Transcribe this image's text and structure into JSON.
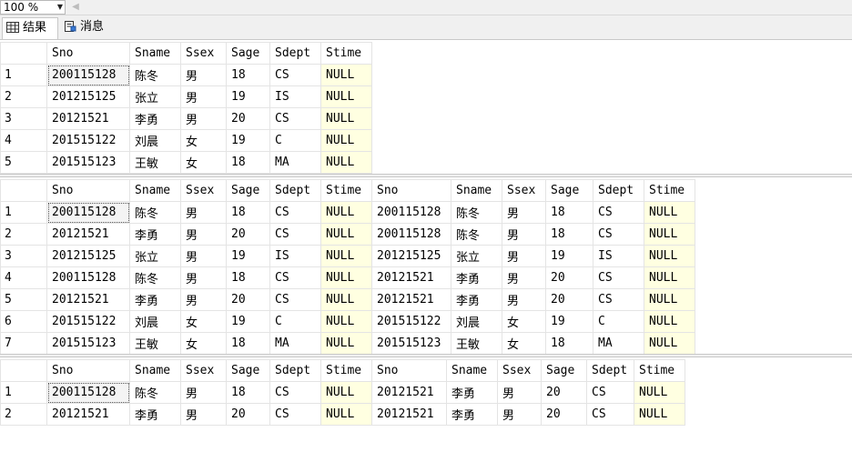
{
  "toolbar": {
    "zoom": "100 %"
  },
  "tabs": [
    {
      "label": "结果"
    },
    {
      "label": "消息"
    }
  ],
  "grids": [
    {
      "columns": [
        "Sno",
        "Sname",
        "Ssex",
        "Sage",
        "Sdept",
        "Stime"
      ],
      "rows": [
        [
          "1",
          "200115128",
          "陈冬",
          "男",
          "18",
          "CS",
          "NULL"
        ],
        [
          "2",
          "201215125",
          "张立",
          "男",
          "19",
          "IS",
          "NULL"
        ],
        [
          "3",
          "20121521",
          "李勇",
          "男",
          "20",
          "CS",
          "NULL"
        ],
        [
          "4",
          "201515122",
          "刘晨",
          "女",
          "19",
          "C",
          "NULL"
        ],
        [
          "5",
          "201515123",
          "王敏",
          "女",
          "18",
          "MA",
          "NULL"
        ]
      ]
    },
    {
      "columns": [
        "Sno",
        "Sname",
        "Ssex",
        "Sage",
        "Sdept",
        "Stime",
        "Sno",
        "Sname",
        "Ssex",
        "Sage",
        "Sdept",
        "Stime"
      ],
      "rows": [
        [
          "1",
          "200115128",
          "陈冬",
          "男",
          "18",
          "CS",
          "NULL",
          "200115128",
          "陈冬",
          "男",
          "18",
          "CS",
          "NULL"
        ],
        [
          "2",
          "20121521",
          "李勇",
          "男",
          "20",
          "CS",
          "NULL",
          "200115128",
          "陈冬",
          "男",
          "18",
          "CS",
          "NULL"
        ],
        [
          "3",
          "201215125",
          "张立",
          "男",
          "19",
          "IS",
          "NULL",
          "201215125",
          "张立",
          "男",
          "19",
          "IS",
          "NULL"
        ],
        [
          "4",
          "200115128",
          "陈冬",
          "男",
          "18",
          "CS",
          "NULL",
          "20121521",
          "李勇",
          "男",
          "20",
          "CS",
          "NULL"
        ],
        [
          "5",
          "20121521",
          "李勇",
          "男",
          "20",
          "CS",
          "NULL",
          "20121521",
          "李勇",
          "男",
          "20",
          "CS",
          "NULL"
        ],
        [
          "6",
          "201515122",
          "刘晨",
          "女",
          "19",
          "C",
          "NULL",
          "201515122",
          "刘晨",
          "女",
          "19",
          "C",
          "NULL"
        ],
        [
          "7",
          "201515123",
          "王敏",
          "女",
          "18",
          "MA",
          "NULL",
          "201515123",
          "王敏",
          "女",
          "18",
          "MA",
          "NULL"
        ]
      ]
    },
    {
      "columns": [
        "Sno",
        "Sname",
        "Ssex",
        "Sage",
        "Sdept",
        "Stime",
        "Sno",
        "Sname",
        "Ssex",
        "Sage",
        "Sdept",
        "Stime"
      ],
      "rows": [
        [
          "1",
          "200115128",
          "陈冬",
          "男",
          "18",
          "CS",
          "NULL",
          "20121521",
          "李勇",
          "男",
          "20",
          "CS",
          "NULL"
        ],
        [
          "2",
          "20121521",
          "李勇",
          "男",
          "20",
          "CS",
          "NULL",
          "20121521",
          "李勇",
          "男",
          "20",
          "CS",
          "NULL"
        ]
      ]
    }
  ]
}
